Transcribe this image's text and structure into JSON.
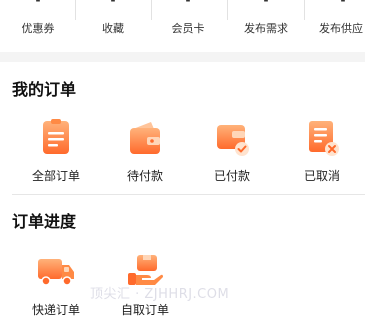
{
  "stats": [
    {
      "value": "-",
      "label": "优惠券"
    },
    {
      "value": "-",
      "label": "收藏"
    },
    {
      "value": "-",
      "label": "会员卡"
    },
    {
      "value": "-",
      "label": "发布需求"
    },
    {
      "value": "-",
      "label": "发布供应"
    }
  ],
  "orders": {
    "title": "我的订单",
    "items": [
      {
        "label": "全部订单",
        "icon": "order-list-icon"
      },
      {
        "label": "待付款",
        "icon": "wallet-icon"
      },
      {
        "label": "已付款",
        "icon": "paid-card-icon"
      },
      {
        "label": "已取消",
        "icon": "cancelled-doc-icon"
      }
    ]
  },
  "progress": {
    "title": "订单进度",
    "items": [
      {
        "label": "快递订单",
        "icon": "delivery-truck-icon"
      },
      {
        "label": "自取订单",
        "icon": "pickup-hand-icon"
      }
    ]
  },
  "watermark": "顶尖汇 · ZJHHRJ.COM",
  "colors": {
    "accent_light": "#ffb27a",
    "accent_dark": "#ff6a2c",
    "band": "#f4f4f4"
  }
}
